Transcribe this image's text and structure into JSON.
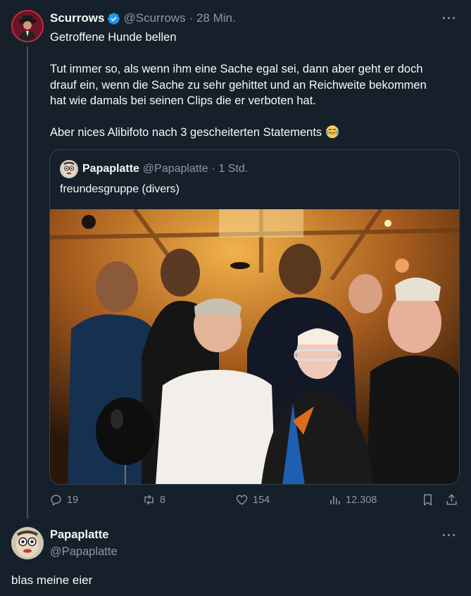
{
  "tweet": {
    "author_name": "Scurrows",
    "author_handle": "@Scurrows",
    "time": "· 28 Min.",
    "text_line1": "Getroffene Hunde bellen",
    "text_p2_l1": "Tut immer so, als wenn ihm eine Sache egal sei, dann aber geht er doch",
    "text_p2_l2": "drauf ein, wenn die Sache zu sehr gehittet und an Reichweite bekommen",
    "text_p2_l3": "hat wie damals bei seinen Clips die er verboten hat.",
    "text_p3": "Aber nices Alibifoto nach 3 gescheiterten Statements",
    "emoji": "face-with-tears-of-joy-icon",
    "more": "···"
  },
  "quoted": {
    "author_name": "Papaplatte",
    "author_handle": "@Papaplatte",
    "time": "· 1 Std.",
    "text": "freundesgruppe (divers)"
  },
  "actions": {
    "replies": "19",
    "retweets": "8",
    "likes": "154",
    "views": "12.308"
  },
  "reply": {
    "author_name": "Papaplatte",
    "author_handle": "@Papaplatte",
    "text": "blas meine eier",
    "more": "···"
  },
  "colors": {
    "background": "#15202b",
    "text": "#f7f9f9",
    "muted": "#8b98a5",
    "verified": "#1d9bf0",
    "border": "#38444d"
  }
}
